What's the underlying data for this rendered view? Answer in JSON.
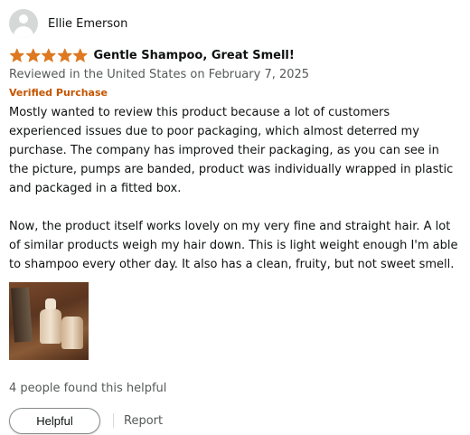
{
  "reviewer": {
    "name": "Ellie Emerson",
    "avatar_icon": "user-avatar-icon"
  },
  "rating": {
    "stars": 5,
    "max": 5,
    "star_color": "#de7921",
    "star_icon": "star-icon"
  },
  "review": {
    "title": "Gentle Shampoo, Great Smell!",
    "date_line": "Reviewed in the United States on February 7, 2025",
    "verified_label": "Verified Purchase",
    "paragraph_1": "Mostly wanted to review this product because a lot of customers experienced issues due to poor packaging, which almost deterred my purchase. The company has improved their packaging, as you can see in the picture, pumps are banded, product was individually wrapped in plastic and packaged in a fitted box.",
    "paragraph_2": "Now, the product itself works lovely on my very fine and straight hair. A lot of similar products weigh my hair down. This is light weight enough I'm able to shampoo every other day. It also has a clean, fruity, but not sweet smell."
  },
  "helpful_count_text": "4 people found this helpful",
  "actions": {
    "helpful_label": "Helpful",
    "report_label": "Report"
  },
  "colors": {
    "verified": "#c45500",
    "secondary_text": "#565959",
    "button_border": "#888c8c"
  }
}
